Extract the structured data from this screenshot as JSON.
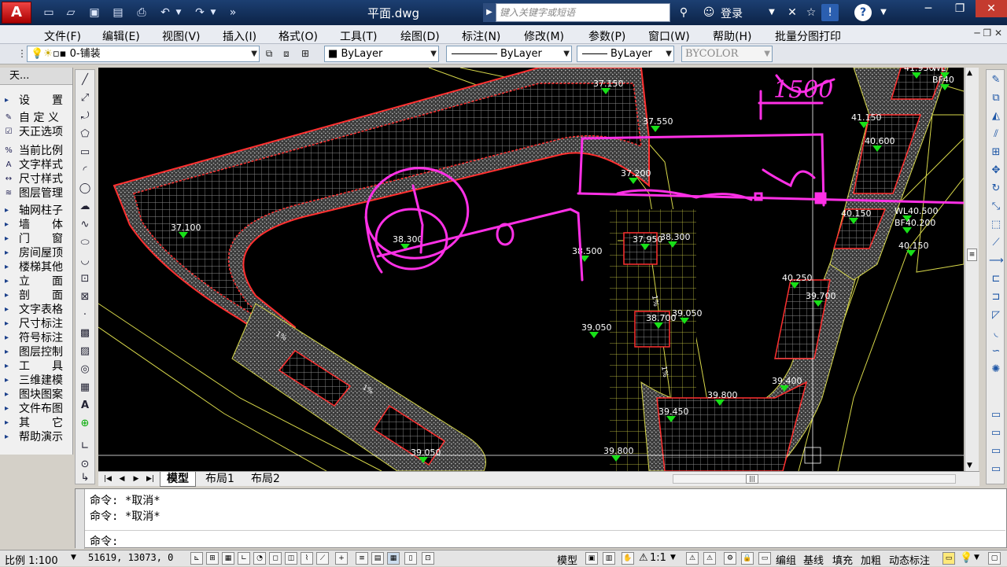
{
  "title_bar": {
    "app_logo": "A",
    "document_title": "平面.dwg",
    "search_placeholder": "键入关键字或短语",
    "login_label": "登录"
  },
  "menu": [
    "文件(F)",
    "编辑(E)",
    "视图(V)",
    "插入(I)",
    "格式(O)",
    "工具(T)",
    "绘图(D)",
    "标注(N)",
    "修改(M)",
    "参数(P)",
    "窗口(W)",
    "帮助(H)",
    "批量分图打印"
  ],
  "layer_toolbar": {
    "current_layer": "0-铺装",
    "color": "ByLayer",
    "linetype": "ByLayer",
    "lineweight": "ByLayer",
    "plot_style": "BYCOLOR"
  },
  "palette": {
    "title": "天...",
    "items": [
      {
        "label": "设　　置",
        "arrow": true
      },
      {
        "label": "自 定 义",
        "arrow": false
      },
      {
        "label": "天正选项",
        "arrow": false
      },
      {
        "label": "当前比例",
        "arrow": false
      },
      {
        "label": "文字样式",
        "arrow": false
      },
      {
        "label": "尺寸样式",
        "arrow": false
      },
      {
        "label": "图层管理",
        "arrow": false
      },
      {
        "label": "轴网柱子",
        "arrow": true
      },
      {
        "label": "墙　　体",
        "arrow": true
      },
      {
        "label": "门　　窗",
        "arrow": true
      },
      {
        "label": "房间屋顶",
        "arrow": true
      },
      {
        "label": "楼梯其他",
        "arrow": true
      },
      {
        "label": "立　　面",
        "arrow": true
      },
      {
        "label": "剖　　面",
        "arrow": true
      },
      {
        "label": "文字表格",
        "arrow": true
      },
      {
        "label": "尺寸标注",
        "arrow": true
      },
      {
        "label": "符号标注",
        "arrow": true
      },
      {
        "label": "图层控制",
        "arrow": true
      },
      {
        "label": "工　　具",
        "arrow": true
      },
      {
        "label": "三维建模",
        "arrow": true
      },
      {
        "label": "图块图案",
        "arrow": true
      },
      {
        "label": "文件布图",
        "arrow": true
      },
      {
        "label": "其　　它",
        "arrow": true
      },
      {
        "label": "帮助演示",
        "arrow": true
      }
    ]
  },
  "drawing": {
    "elevations": [
      "37.150",
      "37.550",
      "37.200",
      "37.100",
      "38.300",
      "38.500",
      "37.950",
      "38.300",
      "39.050",
      "38.700",
      "39.050",
      "39.800",
      "39.400",
      "39.450",
      "39.050",
      "39.800",
      "41.150",
      "40.600",
      "40.150",
      "WL40.500",
      "BF40.200",
      "40.150",
      "40.250",
      "39.700",
      "41.950",
      "WL",
      "BF40"
    ],
    "slope_labels": [
      "1%",
      "1%",
      "1%",
      "1%"
    ],
    "handwriting": "1500"
  },
  "layout_tabs": [
    "模型",
    "布局1",
    "布局2"
  ],
  "command": {
    "history": [
      "命令: *取消*",
      "命令: *取消*"
    ],
    "prompt": "命令:"
  },
  "status": {
    "scale": "比例 1:100",
    "coords": "51619, 13073, 0",
    "model_label": "模型",
    "annotation_scale": "1:1",
    "toggles": [
      "编组",
      "基线",
      "填充",
      "加粗",
      "动态标注"
    ]
  },
  "colors": {
    "title_bg": "#1c3f72",
    "canvas_bg": "#000000",
    "paving_line": "#d8d84a",
    "paving_edge": "#ff3030",
    "elevation_marker": "#18e018",
    "pen": "#ff30e6"
  }
}
